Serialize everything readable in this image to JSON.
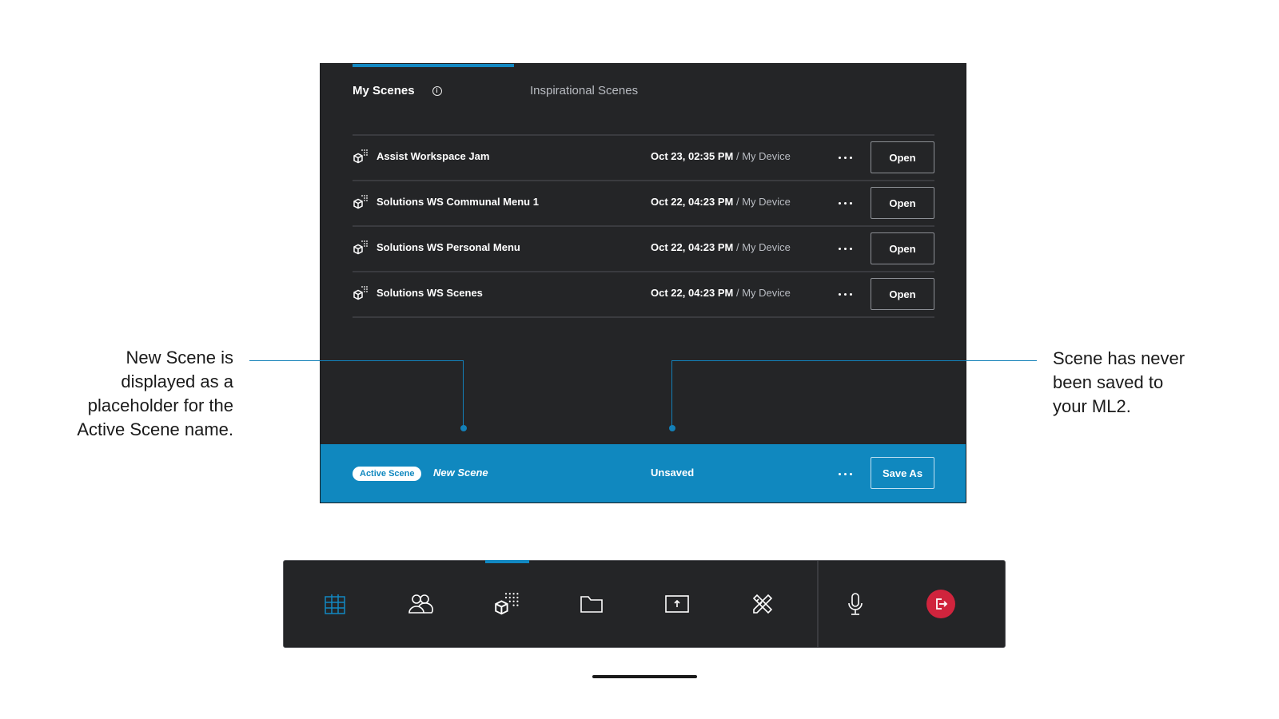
{
  "tabs": {
    "my_scenes": "My Scenes",
    "inspirational": "Inspirational Scenes"
  },
  "scenes": [
    {
      "name": "Assist Workspace Jam",
      "date": "Oct 23, 02:35 PM",
      "separator": "/",
      "device": "My Device",
      "action": "Open"
    },
    {
      "name": "Solutions WS Communal Menu 1",
      "date": "Oct 22, 04:23 PM",
      "separator": "/",
      "device": "My Device",
      "action": "Open"
    },
    {
      "name": "Solutions WS Personal Menu",
      "date": "Oct 22, 04:23 PM",
      "separator": "/",
      "device": "My Device",
      "action": "Open"
    },
    {
      "name": "Solutions WS Scenes",
      "date": "Oct 22, 04:23 PM",
      "separator": "/",
      "device": "My Device",
      "action": "Open"
    }
  ],
  "active": {
    "badge": "Active Scene",
    "name": "New Scene",
    "status": "Unsaved",
    "action": "Save As"
  },
  "annotations": {
    "left": [
      "New Scene is",
      "displayed as a",
      "placeholder for the",
      "Active Scene name."
    ],
    "right": [
      "Scene has never",
      "been saved to",
      "your ML2."
    ]
  },
  "toolbar": {
    "icons": [
      "grid-icon",
      "people-icon",
      "scenes-icon",
      "folder-icon",
      "share-screen-icon",
      "tools-icon",
      "microphone-icon",
      "exit-icon"
    ]
  },
  "colors": {
    "accent": "#1288c2",
    "panel": "#242527",
    "footer": "#1088bf",
    "exit": "#d0243d"
  }
}
